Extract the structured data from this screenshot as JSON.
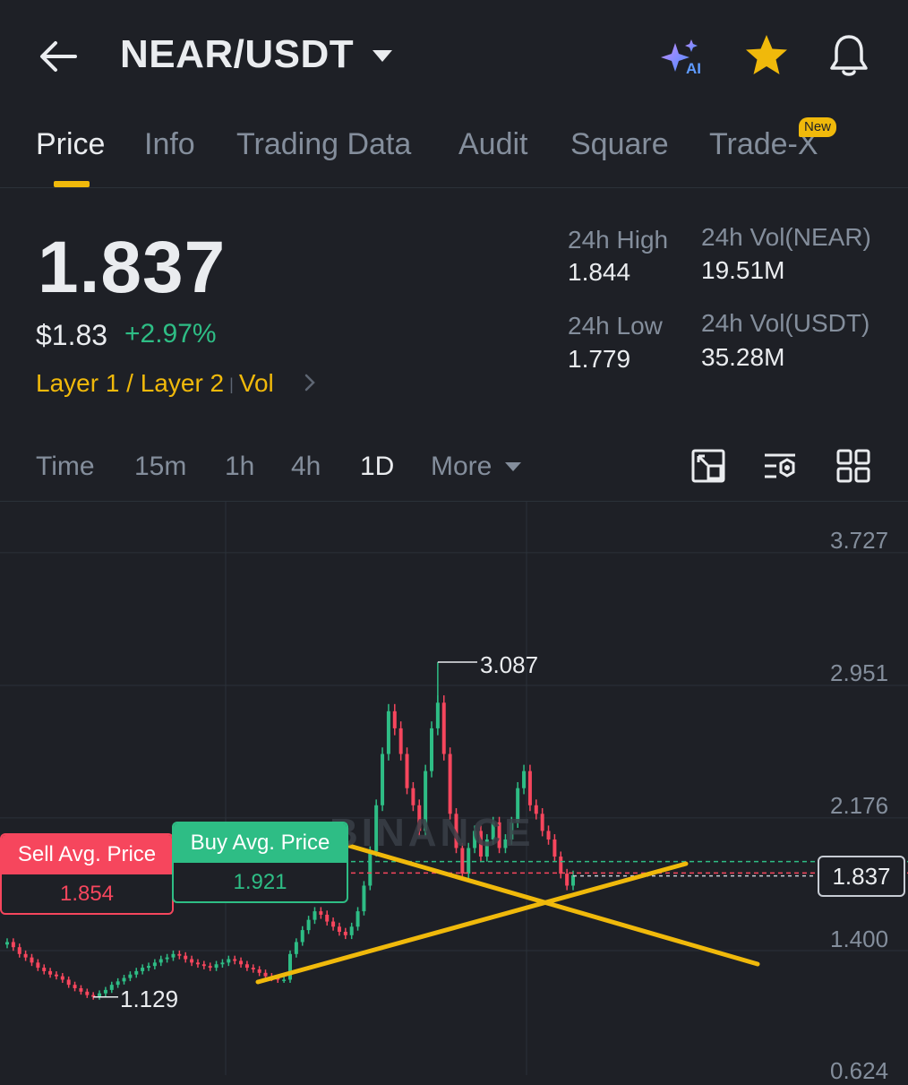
{
  "header": {
    "pair": "NEAR/USDT",
    "icons": [
      "back-arrow-icon",
      "chevron-down-icon",
      "ai-sparkle-icon",
      "star-icon",
      "bell-icon"
    ],
    "ai_label": "AI"
  },
  "tabs": [
    {
      "label": "Price",
      "active": true
    },
    {
      "label": "Info"
    },
    {
      "label": "Trading Data"
    },
    {
      "label": "Audit"
    },
    {
      "label": "Square"
    },
    {
      "label": "Trade-X",
      "badge": "New"
    }
  ],
  "price": {
    "last": "1.837",
    "usd": "$1.83",
    "change": "+2.97%",
    "tag_1": "Layer 1 / Layer 2",
    "tag_2": "Vol"
  },
  "stats": {
    "high_label": "24h High",
    "high_value": "1.844",
    "low_label": "24h Low",
    "low_value": "1.779",
    "vol_base_label": "24h Vol(NEAR)",
    "vol_base_value": "19.51M",
    "vol_quote_label": "24h Vol(USDT)",
    "vol_quote_value": "35.28M"
  },
  "intervals": [
    {
      "label": "Time"
    },
    {
      "label": "15m"
    },
    {
      "label": "1h"
    },
    {
      "label": "4h"
    },
    {
      "label": "1D",
      "active": true
    },
    {
      "label": "More"
    }
  ],
  "toolbar_icons": [
    "fullscreen-icon",
    "indicator-settings-icon",
    "grid-layout-icon"
  ],
  "chart": {
    "y_ticks": [
      "3.727",
      "2.951",
      "2.176",
      "1.400",
      "0.624"
    ],
    "high_marker": "3.087",
    "low_marker": "1.129",
    "current_price": "1.837",
    "sell_avg_label": "Sell Avg. Price",
    "sell_avg_value": "1.854",
    "buy_avg_label": "Buy Avg. Price",
    "buy_avg_value": "1.921",
    "watermark": "BINANCE",
    "colors": {
      "up": "#2ebd85",
      "down": "#f6465d",
      "trendline": "#f0b90b"
    }
  },
  "chart_data": {
    "type": "candlestick",
    "interval": "1D",
    "y_ticks": [
      3.727,
      2.951,
      2.176,
      1.4,
      0.624
    ],
    "ylim": [
      0.624,
      3.727
    ],
    "annotations": {
      "max": 3.087,
      "min": 1.129,
      "last": 1.837,
      "sell_avg": 1.854,
      "buy_avg": 1.921
    },
    "close_series": [
      1.45,
      1.42,
      1.38,
      1.36,
      1.33,
      1.3,
      1.28,
      1.26,
      1.25,
      1.23,
      1.2,
      1.18,
      1.16,
      1.14,
      1.13,
      1.15,
      1.17,
      1.2,
      1.22,
      1.24,
      1.26,
      1.28,
      1.3,
      1.31,
      1.33,
      1.35,
      1.36,
      1.38,
      1.37,
      1.35,
      1.33,
      1.32,
      1.31,
      1.3,
      1.32,
      1.33,
      1.35,
      1.34,
      1.32,
      1.3,
      1.29,
      1.27,
      1.25,
      1.24,
      1.23,
      1.23,
      1.38,
      1.45,
      1.52,
      1.58,
      1.63,
      1.61,
      1.57,
      1.54,
      1.51,
      1.49,
      1.54,
      1.63,
      1.78,
      1.98,
      2.25,
      2.55,
      2.8,
      2.7,
      2.55,
      2.35,
      2.25,
      2.1,
      2.45,
      2.7,
      2.85,
      2.55,
      2.2,
      2.0,
      1.85,
      2.0,
      2.1,
      1.95,
      2.05,
      2.15,
      2.0,
      2.05,
      2.15,
      2.35,
      2.45,
      2.25,
      2.2,
      2.1,
      2.05,
      1.95,
      1.85,
      1.78,
      1.84
    ]
  }
}
